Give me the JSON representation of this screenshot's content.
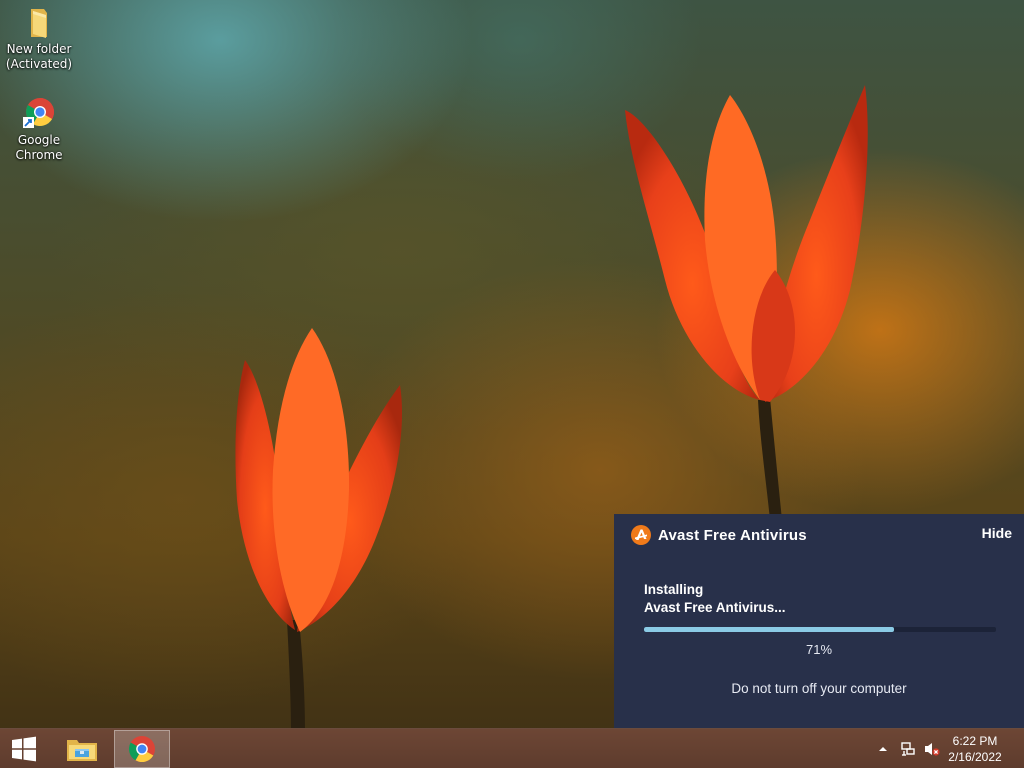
{
  "desktop": {
    "icons": [
      {
        "label_line1": "New folder",
        "label_line2": "(Activated)",
        "icon": "folder-icon"
      },
      {
        "label_line1": "Google",
        "label_line2": "Chrome",
        "icon": "chrome-icon"
      }
    ]
  },
  "avast_popup": {
    "title": "Avast Free Antivirus",
    "hide_label": "Hide",
    "status_line1": "Installing",
    "status_line2": "Avast Free Antivirus...",
    "progress_percent": 71,
    "progress_label": "71%",
    "warning": "Do not turn off your computer",
    "colors": {
      "background": "#28304a",
      "progress_fill": "#8bcbe6",
      "logo": "#f07a1a"
    }
  },
  "taskbar": {
    "start_icon": "windows-logo-icon",
    "apps": [
      {
        "name": "File Explorer",
        "icon": "file-explorer-icon",
        "active": false
      },
      {
        "name": "Google Chrome",
        "icon": "chrome-icon",
        "active": true
      }
    ],
    "tray": {
      "icons": [
        "show-hidden-icons-chevron",
        "network-icon",
        "volume-muted-icon"
      ],
      "time": "6:22 PM",
      "date": "2/16/2022"
    },
    "color": "#5e3c2d"
  }
}
